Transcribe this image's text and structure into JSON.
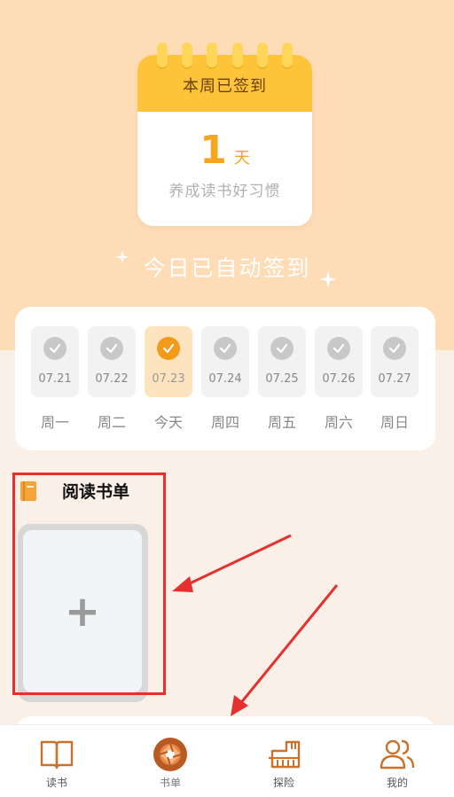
{
  "checkin": {
    "header": "本周已签到",
    "days_count": "1",
    "days_unit": "天",
    "slogan": "养成读书好习惯",
    "auto_signed": "今日已自动签到"
  },
  "week": [
    {
      "date": "07.21",
      "label": "周一",
      "checked": true,
      "today": false
    },
    {
      "date": "07.22",
      "label": "周二",
      "checked": true,
      "today": false
    },
    {
      "date": "07.23",
      "label": "今天",
      "checked": true,
      "today": true
    },
    {
      "date": "07.24",
      "label": "周四",
      "checked": true,
      "today": false
    },
    {
      "date": "07.25",
      "label": "周五",
      "checked": true,
      "today": false
    },
    {
      "date": "07.26",
      "label": "周六",
      "checked": true,
      "today": false
    },
    {
      "date": "07.27",
      "label": "周日",
      "checked": true,
      "today": false
    }
  ],
  "reading_list": {
    "title": "阅读书单",
    "add_symbol": "+"
  },
  "nav": [
    {
      "label": "读书",
      "icon": "book-open-icon"
    },
    {
      "label": "书单",
      "icon": "aperture-icon",
      "active": true
    },
    {
      "label": "探险",
      "icon": "piano-icon"
    },
    {
      "label": "我的",
      "icon": "users-icon"
    }
  ],
  "colors": {
    "accent": "#f5a623",
    "calendar_header": "#fdc43a",
    "top_background": "#fddcb6",
    "annotation_red": "#e53030",
    "nav_icon": "#c8722e"
  }
}
